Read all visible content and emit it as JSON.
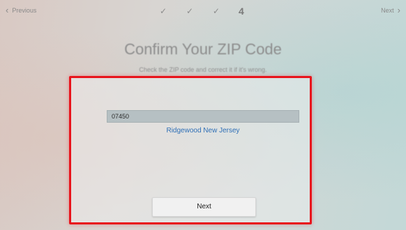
{
  "header": {
    "previous_label": "Previous",
    "next_label": "Next",
    "steps": [
      {
        "state": "done",
        "symbol": "✓"
      },
      {
        "state": "done",
        "symbol": "✓"
      },
      {
        "state": "done",
        "symbol": "✓"
      },
      {
        "state": "current",
        "symbol": "4"
      }
    ]
  },
  "page": {
    "title": "Confirm Your ZIP Code",
    "subtitle": "Check the ZIP code and correct it if it's wrong."
  },
  "form": {
    "zip_value": "07450",
    "location_text": "Ridgewood New Jersey",
    "next_button_label": "Next"
  },
  "colors": {
    "highlight_border": "#e8141c",
    "link_blue": "#2f6fb6"
  },
  "icons": {
    "previous": "chevron-left-icon",
    "next": "chevron-right-icon",
    "step_done": "checkmark-icon"
  }
}
